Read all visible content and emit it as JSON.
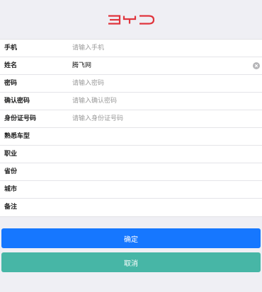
{
  "brand": {
    "logo_text": "BYD",
    "color": "#e0353d"
  },
  "form": {
    "fields": [
      {
        "label": "手机",
        "placeholder": "请输入手机",
        "value": ""
      },
      {
        "label": "姓名",
        "placeholder": "",
        "value": "腾飞网"
      },
      {
        "label": "密码",
        "placeholder": "请输入密码",
        "value": ""
      },
      {
        "label": "确认密码",
        "placeholder": "请输入确认密码",
        "value": ""
      },
      {
        "label": "身份证号码",
        "placeholder": "请输入身份证号码",
        "value": ""
      },
      {
        "label": "熟悉车型",
        "placeholder": "",
        "value": ""
      },
      {
        "label": "职业",
        "placeholder": "",
        "value": ""
      },
      {
        "label": "省份",
        "placeholder": "",
        "value": ""
      },
      {
        "label": "城市",
        "placeholder": "",
        "value": ""
      },
      {
        "label": "备注",
        "placeholder": "",
        "value": ""
      }
    ]
  },
  "buttons": {
    "confirm_label": "确定",
    "cancel_label": "取消"
  },
  "icons": {
    "clear": "clear-icon"
  },
  "colors": {
    "primary": "#1677ff",
    "secondary": "#47b6a6",
    "page_bg": "#efeff4"
  }
}
